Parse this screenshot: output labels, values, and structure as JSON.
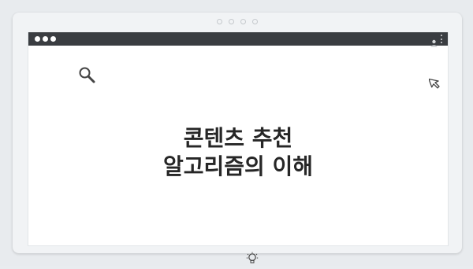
{
  "slide": {
    "title_line1": "콘텐츠 추천",
    "title_line2": "알고리즘의 이해"
  },
  "icons": {
    "search": "search-icon",
    "cursor": "cursor-icon",
    "lightbulb": "lightbulb-icon",
    "user": "user-icon",
    "menu": "kebab-menu-icon"
  },
  "colors": {
    "titlebar": "#3a3d41",
    "title_text": "#262626",
    "icon_stroke": "#444444"
  }
}
